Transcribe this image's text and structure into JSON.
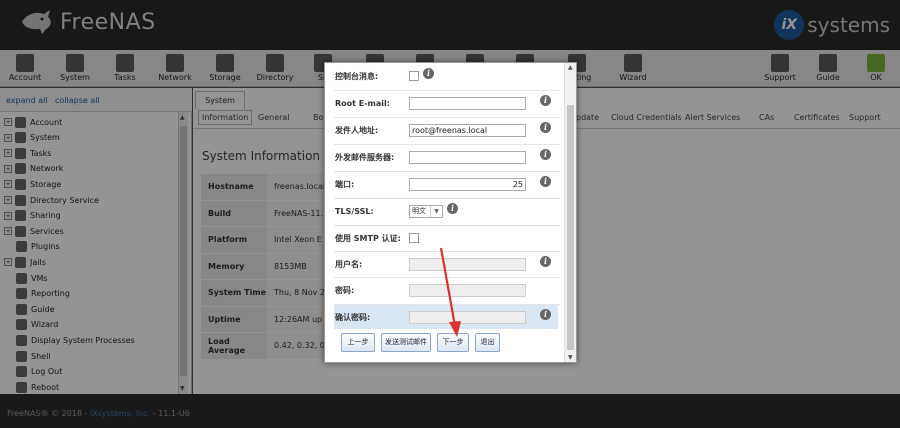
{
  "header": {
    "brand": "FreeNAS",
    "ix_mark": "iX",
    "ix_text": "systems"
  },
  "toolbar": {
    "left": [
      {
        "label": "Account",
        "icon": "users-icon"
      },
      {
        "label": "System",
        "icon": "computer-icon"
      },
      {
        "label": "Tasks",
        "icon": "calendar-icon"
      },
      {
        "label": "Network",
        "icon": "network-icon"
      },
      {
        "label": "Storage",
        "icon": "storage-icon"
      },
      {
        "label": "Directory",
        "icon": "directory-icon"
      },
      {
        "label": "Sh",
        "icon": "sharing-icon"
      },
      {
        "label": "",
        "icon": "services-icon"
      },
      {
        "label": "",
        "icon": "plugins-icon"
      },
      {
        "label": "",
        "icon": "jails-icon"
      },
      {
        "label": "",
        "icon": "vm-icon"
      },
      {
        "label": "porting",
        "icon": "reporting-icon"
      },
      {
        "label": "Wizard",
        "icon": "wizard-icon"
      }
    ],
    "right": [
      {
        "label": "Support",
        "icon": "support-icon"
      },
      {
        "label": "Guide",
        "icon": "guide-icon"
      },
      {
        "label": "OK",
        "icon": "ok-icon"
      }
    ]
  },
  "left_panel": {
    "expand_all": "expand all",
    "collapse_all": "collapse all",
    "tree": [
      {
        "label": "Account",
        "expandable": true
      },
      {
        "label": "System",
        "expandable": true
      },
      {
        "label": "Tasks",
        "expandable": true
      },
      {
        "label": "Network",
        "expandable": true
      },
      {
        "label": "Storage",
        "expandable": true
      },
      {
        "label": "Directory Service",
        "expandable": true
      },
      {
        "label": "Sharing",
        "expandable": true
      },
      {
        "label": "Services",
        "expandable": true
      },
      {
        "label": "Plugins",
        "expandable": false
      },
      {
        "label": "Jails",
        "expandable": true
      },
      {
        "label": "VMs",
        "expandable": false
      },
      {
        "label": "Reporting",
        "expandable": false
      },
      {
        "label": "Guide",
        "expandable": false
      },
      {
        "label": "Wizard",
        "expandable": false
      },
      {
        "label": "Display System Processes",
        "expandable": false
      },
      {
        "label": "Shell",
        "expandable": false
      },
      {
        "label": "Log Out",
        "expandable": false
      },
      {
        "label": "Reboot",
        "expandable": false
      }
    ]
  },
  "main": {
    "tab": "System",
    "subtabs": [
      "Information",
      "General",
      "Bo",
      "pdate",
      "Cloud Credentials",
      "Alert Services",
      "CAs",
      "Certificates",
      "Support"
    ],
    "info_title": "System Information",
    "info": [
      {
        "key": "Hostname",
        "value": "freenas.local"
      },
      {
        "key": "Build",
        "value": "FreeNAS-11.1"
      },
      {
        "key": "Platform",
        "value": "Intel Xeon E"
      },
      {
        "key": "Memory",
        "value": "8153MB"
      },
      {
        "key": "System Time",
        "value": "Thu, 8 Nov 2"
      },
      {
        "key": "Uptime",
        "value": "12:26AM up"
      },
      {
        "key": "Load Average",
        "value": "0.42, 0.32, 0"
      }
    ]
  },
  "dialog": {
    "fields": [
      {
        "label": "控制台消息:",
        "type": "checkbox",
        "help": true
      },
      {
        "label": "Root E-mail:",
        "type": "text",
        "value": "",
        "help": true
      },
      {
        "label": "发件人地址:",
        "type": "text",
        "value": "root@freenas.local",
        "help": true
      },
      {
        "label": "外发邮件服务器:",
        "type": "text",
        "value": "",
        "help": true
      },
      {
        "label": "端口:",
        "type": "text",
        "value": "25",
        "help": true
      },
      {
        "label": "TLS/SSL:",
        "type": "select",
        "value": "明文",
        "help": true
      },
      {
        "label": "使用 SMTP 认证:",
        "type": "checkbox",
        "help": false
      },
      {
        "label": "用户名:",
        "type": "disabled",
        "value": "",
        "help": true
      },
      {
        "label": "密码:",
        "type": "disabled",
        "value": "",
        "help": false
      },
      {
        "label": "确认密码:",
        "type": "disabled",
        "value": "",
        "help": true
      }
    ],
    "buttons": {
      "prev": "上一步",
      "test": "发送测试邮件",
      "next": "下一步",
      "exit": "退出"
    },
    "help_glyph": "i"
  },
  "footer": {
    "text": "FreeNAS® © 2018 - ",
    "company": "iXsystems, Inc.",
    "version": " - 11.1-U6"
  },
  "colors": {
    "header_bg": "#2a2a2a",
    "link": "#2a63a8",
    "highlight": "#d9e7f4",
    "arrow": "#e0302a"
  }
}
